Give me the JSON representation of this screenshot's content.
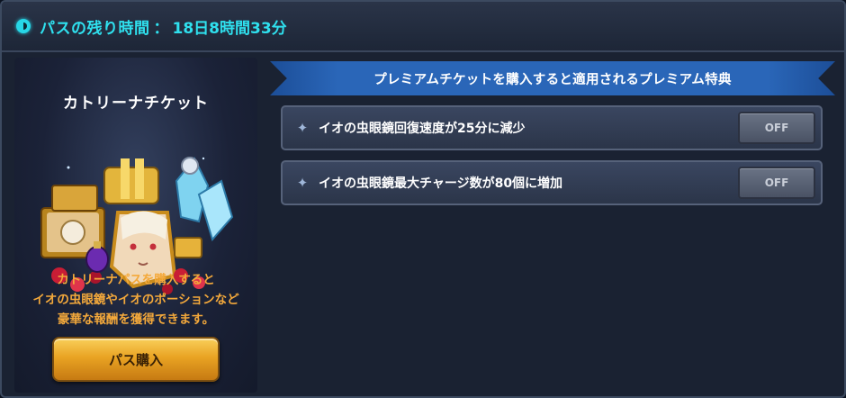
{
  "header": {
    "label": "パスの残り時間",
    "separator": "：",
    "remaining_time": "18日8時間33分",
    "icon": "clock-icon",
    "accent_color": "#2fe0ee"
  },
  "ticket": {
    "title": "カトリーナチケット",
    "description_lines": [
      "カトリーナパスを購入すると",
      "イオの虫眼鏡やイオのポーションなど",
      "豪華な報酬を獲得できます。"
    ],
    "buy_button_label": "パス購入"
  },
  "benefits": {
    "banner_text": "プレミアムチケットを購入すると適用されるプレミアム特典",
    "items": [
      {
        "text": "イオの虫眼鏡回復速度が25分に減少",
        "toggle_label": "OFF",
        "icon": "star-icon"
      },
      {
        "text": "イオの虫眼鏡最大チャージ数が80個に増加",
        "toggle_label": "OFF",
        "icon": "star-icon"
      }
    ]
  }
}
